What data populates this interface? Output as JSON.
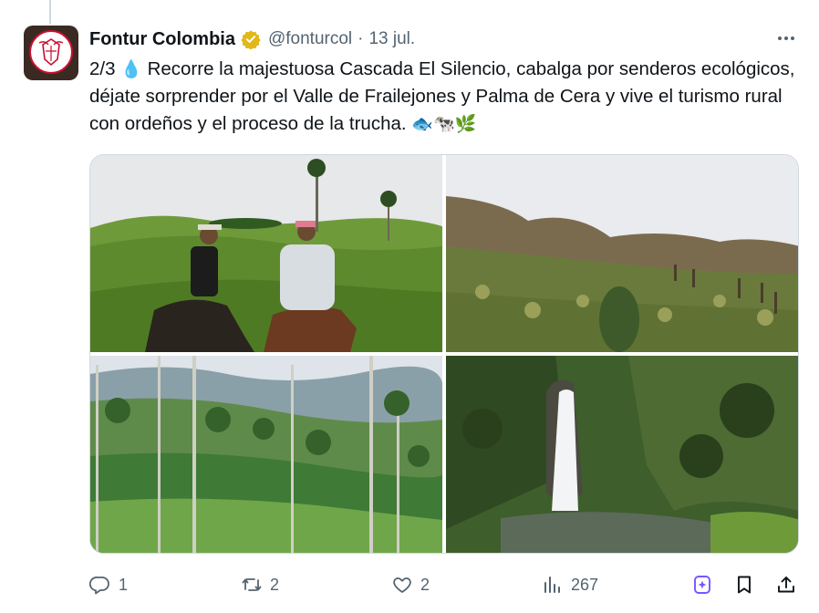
{
  "tweet": {
    "author_name": "Fontur Colombia",
    "handle": "@fonturcol",
    "separator": "·",
    "date": "13 jul.",
    "text_prefix": "2/3",
    "text_emoji_drop": "💧",
    "text_body": "Recorre la majestuosa Cascada El Silencio, cabalga por senderos ecológicos, déjate sorprender por el Valle de Frailejones y Palma de Cera y vive el turismo rural con ordeños y el proceso de la trucha.",
    "text_emojis_end": "🐟🐄🌿",
    "verified_color": "#e2b719"
  },
  "actions": {
    "reply_count": "1",
    "retweet_count": "2",
    "like_count": "2",
    "views_count": "267"
  },
  "colors": {
    "text_primary": "#0f1419",
    "text_secondary": "#536471",
    "grok_accent": "#7856ff",
    "border": "#cfd9de"
  },
  "icons": [
    "more-icon",
    "verified-badge-icon",
    "reply-icon",
    "retweet-icon",
    "like-icon",
    "views-icon",
    "grok-icon",
    "bookmark-icon",
    "share-icon"
  ]
}
